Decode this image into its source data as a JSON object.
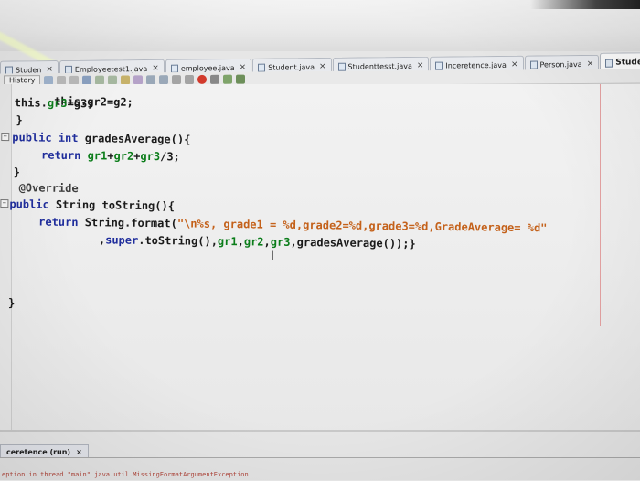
{
  "tabs": [
    {
      "label": "Studen",
      "active": false
    },
    {
      "label": "Employeetest1.java",
      "active": false
    },
    {
      "label": "employee.java",
      "active": false
    },
    {
      "label": "Student.java",
      "active": false
    },
    {
      "label": "Studenttesst.java",
      "active": false
    },
    {
      "label": "Inceretence.java",
      "active": false
    },
    {
      "label": "Person.java",
      "active": false
    },
    {
      "label": "Student.java",
      "active": true
    }
  ],
  "toolbar": {
    "history_label": "History"
  },
  "code": {
    "l0": "this.gr2=g2;",
    "l1a": "this.",
    "l1b": "gr3",
    "l1c": "=g3;",
    "l2": "}",
    "l3a": "public int ",
    "l3b": "gradesAverage(){",
    "l4a": "return ",
    "l4b": "gr1",
    "l4c": "+",
    "l4d": "gr2",
    "l4e": "+",
    "l4f": "gr3",
    "l4g": "/3;",
    "l5": "}",
    "l6": "@Override",
    "l7a": "public ",
    "l7b": "String toString(){",
    "l8a": "return ",
    "l8b": "String.format(",
    "l8c": "\"\\n%s, grade1 = %d,grade2=%d,grade3=%d,GradeAverage= %d\"",
    "l9a": ",",
    "l9b": "super",
    "l9c": ".toString(),",
    "l9d": "gr1",
    "l9e": ",",
    "l9f": "gr2",
    "l9g": ",",
    "l9h": "gr3",
    "l9i": ",gradesAverage());}",
    "l10": "}"
  },
  "output": {
    "tab_label": "ceretence (run)",
    "close": "×",
    "text": "eption in thread \"main\" java.util.MissingFormatArgumentException"
  },
  "colors": {
    "keyword": "#1f2d9c",
    "field": "#0b7d1a",
    "string": "#c4611a"
  }
}
